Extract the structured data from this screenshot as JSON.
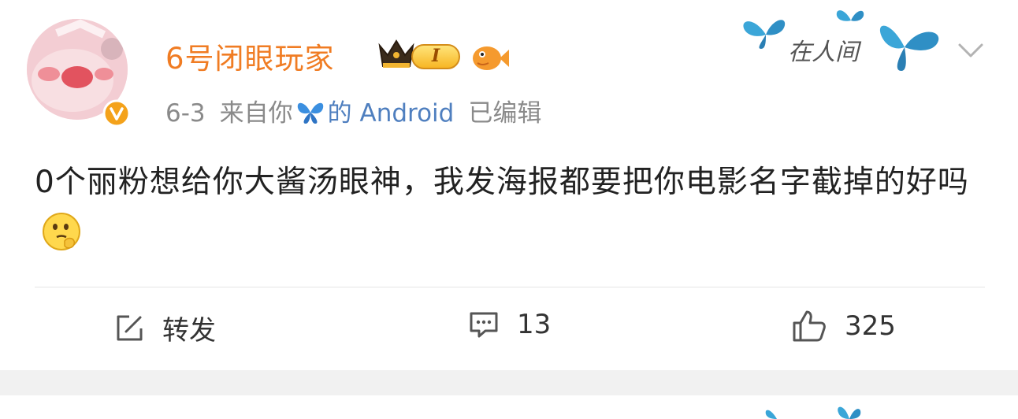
{
  "post": {
    "username": "6号闭眼玩家",
    "level_badge": "I",
    "date": "6-3",
    "source_prefix": "来自你",
    "source_suffix": "的 Android",
    "edited": "已编辑",
    "text": "0个丽粉想给你大酱汤眼神，我发海报都要把你电影名字截掉的好吗",
    "decoration_text": "在人间"
  },
  "actions": {
    "repost_label": "转发",
    "comment_count": "13",
    "like_count": "325"
  },
  "colors": {
    "username": "#f07c23",
    "source": "#4f7fbf",
    "meta": "#8a8a8a",
    "butterfly": "#3ba6d8"
  },
  "icons": [
    "avatar",
    "verified-badge-icon",
    "crown-icon",
    "level-badge",
    "fish-icon",
    "butterfly-icon",
    "thinking-emoji-icon",
    "chevron-down-icon",
    "repost-icon",
    "comment-icon",
    "like-icon"
  ]
}
